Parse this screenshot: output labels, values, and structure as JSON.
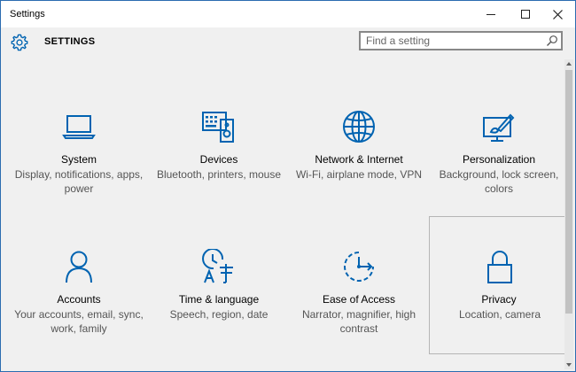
{
  "window": {
    "title": "Settings"
  },
  "titlebar": {
    "minimize": "—",
    "maximize": "☐",
    "close": "✕"
  },
  "header": {
    "title": "SETTINGS"
  },
  "search": {
    "placeholder": "Find a setting"
  },
  "accent_color": "#0063b1",
  "tiles": [
    {
      "title": "System",
      "desc": "Display, notifications, apps, power",
      "icon": "laptop-icon"
    },
    {
      "title": "Devices",
      "desc": "Bluetooth, printers, mouse",
      "icon": "keyboard-speaker-icon"
    },
    {
      "title": "Network & Internet",
      "desc": "Wi-Fi, airplane mode, VPN",
      "icon": "globe-icon"
    },
    {
      "title": "Personalization",
      "desc": "Background, lock screen, colors",
      "icon": "paint-brush-icon"
    },
    {
      "title": "Accounts",
      "desc": "Your accounts, email, sync, work, family",
      "icon": "person-icon"
    },
    {
      "title": "Time & language",
      "desc": "Speech, region, date",
      "icon": "clock-language-icon"
    },
    {
      "title": "Ease of Access",
      "desc": "Narrator, magnifier, high contrast",
      "icon": "ease-of-access-icon"
    },
    {
      "title": "Privacy",
      "desc": "Location, camera",
      "icon": "lock-icon"
    }
  ]
}
